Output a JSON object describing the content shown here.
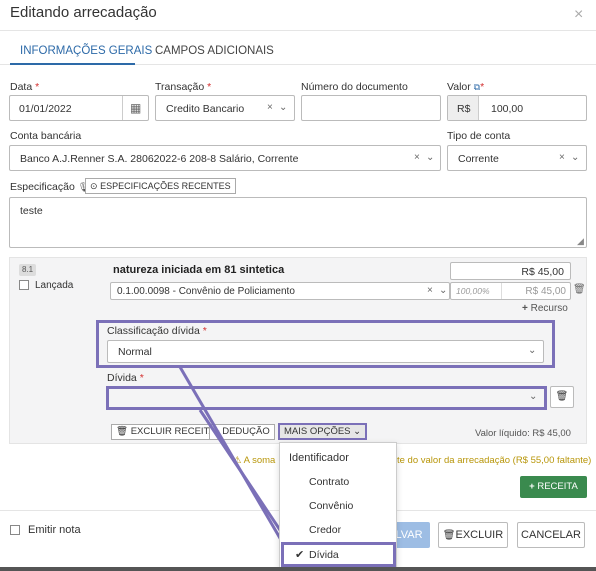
{
  "modal": {
    "title": "Editando arrecadação",
    "close_icon": "×"
  },
  "tabs": [
    {
      "label": "INFORMAÇÕES GERAIS",
      "active": true
    },
    {
      "label": "CAMPOS ADICIONAIS",
      "active": false
    }
  ],
  "form": {
    "data": {
      "label": "Data",
      "value": "01/01/2022"
    },
    "transacao": {
      "label": "Transação",
      "value": "Credito Bancario"
    },
    "numero_documento": {
      "label": "Número do documento",
      "value": ""
    },
    "valor": {
      "label": "Valor",
      "prefix": "R$",
      "value": "100,00"
    },
    "conta_bancaria": {
      "label": "Conta bancária",
      "value": "Banco A.J.Renner S.A. 28062022-6 208-8 Salário, Corrente"
    },
    "tipo_conta": {
      "label": "Tipo de conta",
      "value": "Corrente"
    },
    "especificacao": {
      "label": "Especificação",
      "recentes_button": "ESPECIFICAÇÕES RECENTES",
      "value": "teste"
    }
  },
  "receita": {
    "badge": "8.1",
    "lancada_label": "Lançada",
    "title": "natureza iniciada em 81 sintetica",
    "amount": "R$ 45,00",
    "natureza_value": "0.1.00.0098 - Convênio de Policiamento",
    "percent": "100,00%",
    "sub_amount": "R$ 45,00",
    "recurso_link": "Recurso",
    "classificacao": {
      "label": "Classificação dívida",
      "value": "Normal"
    },
    "divida": {
      "label": "Dívida",
      "value": ""
    },
    "buttons": {
      "excluir_receita": "EXCLUIR RECEITA",
      "deducao": "DEDUÇÃO",
      "mais_opcoes": "MAIS OPÇÕES"
    },
    "valor_liquido": "Valor líquido: R$ 45,00"
  },
  "warning": {
    "left": "A soma",
    "right": "te do valor da arrecadação (R$ 55,00 faltante)"
  },
  "add_receita_button": "RECEITA",
  "dropdown": {
    "header": "Identificador",
    "options": [
      {
        "label": "Contrato",
        "checked": false
      },
      {
        "label": "Convênio",
        "checked": false
      },
      {
        "label": "Credor",
        "checked": false
      },
      {
        "label": "Dívida",
        "checked": true
      }
    ]
  },
  "footer": {
    "emitir_nota": "Emitir nota",
    "salvar_fragment": "LVAR",
    "excluir": "EXCLUIR",
    "cancelar": "CANCELAR"
  },
  "colors": {
    "accent": "#2d6aa8",
    "highlight": "#7b70b8",
    "green": "#3a8a4e",
    "required": "#d32f2f",
    "warning": "#c9a400"
  }
}
